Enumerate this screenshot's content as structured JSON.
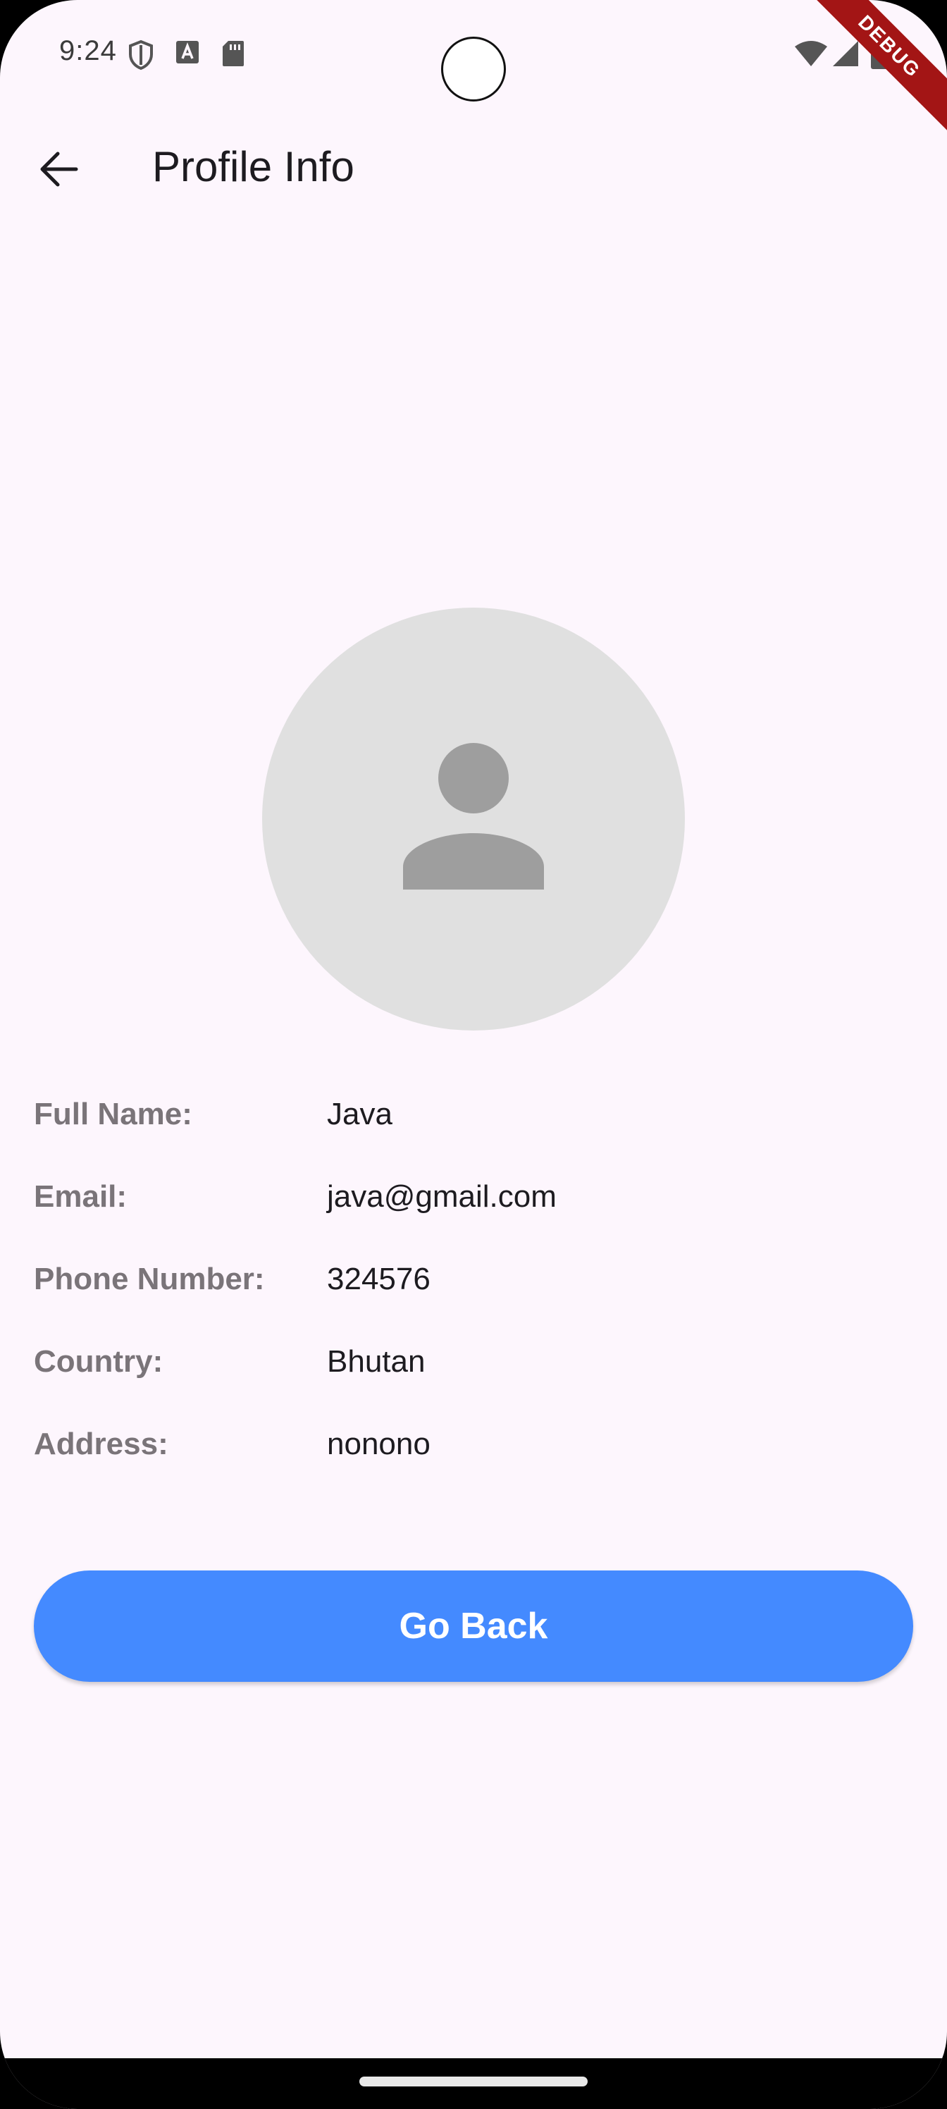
{
  "status_bar": {
    "time": "9:24",
    "left_icons": [
      "shield-icon",
      "font-a-icon",
      "sd-card-icon"
    ],
    "right_icons": [
      "wifi-icon",
      "cell-signal-icon",
      "battery-icon"
    ]
  },
  "debug_banner": "DEBUG",
  "app_bar": {
    "back_icon": "arrow-back-icon",
    "title": "Profile Info"
  },
  "avatar": {
    "icon": "person-icon"
  },
  "profile": {
    "rows": [
      {
        "label": "Full Name:",
        "value": "Java"
      },
      {
        "label": "Email:",
        "value": "java@gmail.com"
      },
      {
        "label": "Phone Number:",
        "value": "324576"
      },
      {
        "label": "Country:",
        "value": "Bhutan"
      },
      {
        "label": "Address:",
        "value": "nonono"
      }
    ]
  },
  "actions": {
    "go_back_label": "Go Back"
  },
  "colors": {
    "background": "#fdf6fd",
    "accent": "#448aff",
    "label": "#7a7479",
    "text": "#1d1b20",
    "avatar_bg": "#e0e0e0",
    "avatar_icon": "#9e9e9e"
  }
}
